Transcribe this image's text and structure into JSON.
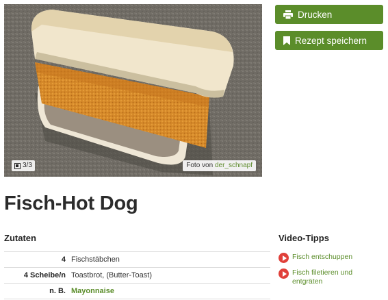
{
  "photo": {
    "counter": "3/3",
    "credit_prefix": "Foto von",
    "credit_author": "der_schnapf"
  },
  "actions": {
    "print_label": "Drucken",
    "save_label": "Rezept speichern",
    "button_color": "#5b8d2a"
  },
  "recipe": {
    "title": "Fisch-Hot Dog"
  },
  "ingredients": {
    "heading": "Zutaten",
    "rows": [
      {
        "amount": "4",
        "name": "Fischstäbchen"
      },
      {
        "amount": "4 Scheibe/n",
        "name": "Toastbrot, (Butter-Toast)"
      },
      {
        "amount": "n. B.",
        "name": "Mayonnaise"
      }
    ]
  },
  "videos": {
    "heading": "Video-Tipps",
    "items": [
      {
        "label": "Fisch entschuppen",
        "icon": "play-icon"
      },
      {
        "label": "Fisch filetieren und entgräten",
        "icon": "play-icon"
      }
    ]
  }
}
